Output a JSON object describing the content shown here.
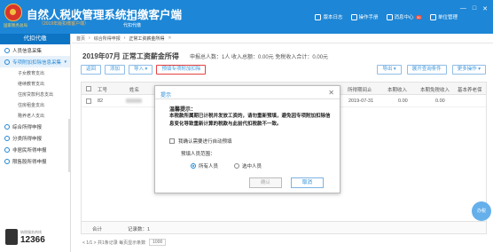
{
  "app": {
    "title": "自然人税收管理系统扣缴客户端",
    "subtitle": "（2019年版扣缴客户端）",
    "emblem_text": "国家税务总局",
    "agent_label": "代扣代缴"
  },
  "top_links": [
    {
      "icon": "version-icon",
      "label": "版本日志"
    },
    {
      "icon": "manual-icon",
      "label": "操作手册"
    },
    {
      "icon": "message-icon",
      "label": "消息中心",
      "badge": "30"
    },
    {
      "icon": "unit-icon",
      "label": "单位管理"
    }
  ],
  "window_controls": [
    "—",
    "□",
    "✕"
  ],
  "sidebar": {
    "header": "代扣代缴",
    "items": [
      {
        "label": "人员信息采集",
        "icon": "person-icon",
        "active": false
      },
      {
        "label": "专项附加扣除信息采集",
        "icon": "list-icon",
        "active": true,
        "arrow": "▾"
      },
      {
        "label": "子女教育支出",
        "sub": true
      },
      {
        "label": "继续教育支出",
        "sub": true
      },
      {
        "label": "住房贷款利息支出",
        "sub": true
      },
      {
        "label": "住房租金支出",
        "sub": true
      },
      {
        "label": "赡养老人支出",
        "sub": true
      },
      {
        "label": "综合所得申报",
        "icon": "report-icon",
        "active": false
      },
      {
        "label": "分类所得申报",
        "icon": "category-icon",
        "active": false
      },
      {
        "label": "非居民所得申报",
        "icon": "nonresident-icon",
        "active": false
      },
      {
        "label": "限售股所得申报",
        "icon": "stock-icon",
        "active": false
      }
    ],
    "footer_text": "纳税服务热线",
    "hotline": "12366"
  },
  "breadcrumb": {
    "home": "首页",
    "items": [
      "综合所得申报",
      "正常工资薪金所得"
    ],
    "close": "✕"
  },
  "header": {
    "period": "2019年07月 正常工资薪金所得",
    "summary": "申报总人数：1人   收入总额：0.00元   免税收入合计：0.00元"
  },
  "toolbar": {
    "buttons": [
      "返回",
      "添加",
      "导入 ▾",
      "预填专项附加扣除"
    ],
    "right_buttons": [
      "导出 ▾",
      "展开查询条件",
      "更多操作 ▾"
    ]
  },
  "table": {
    "columns": [
      "",
      "工号",
      "姓名",
      "所得期间止",
      "本期收入",
      "本期免税收入",
      "基本养老保"
    ],
    "rows": [
      {
        "checked": false,
        "id": "82",
        "name": "",
        "period_end": "2019-07-31",
        "income": "0.00",
        "exempt": "0.00"
      }
    ],
    "footer": {
      "label": "合计",
      "records": "记录数：1"
    }
  },
  "pager": {
    "text": "< 1/1 >  共1条记录  每页显示条数",
    "page_size": "1000"
  },
  "float_button": "办税",
  "modal": {
    "title": "提示",
    "close": "✕",
    "warm_title": "温馨提示：",
    "message": "本税款所属期已计税并发放工资的，请勿重新预填，避免因专项附加扣除信息变化导致重新计算的税款与此前代扣税款不一致。",
    "checkbox_label": "我确认需要进行自动预填",
    "scope_label": "预填人员范围：",
    "radio_options": [
      {
        "label": "所有人员",
        "selected": true
      },
      {
        "label": "选中人员",
        "selected": false
      }
    ],
    "confirm": "确认",
    "cancel": "取消"
  }
}
